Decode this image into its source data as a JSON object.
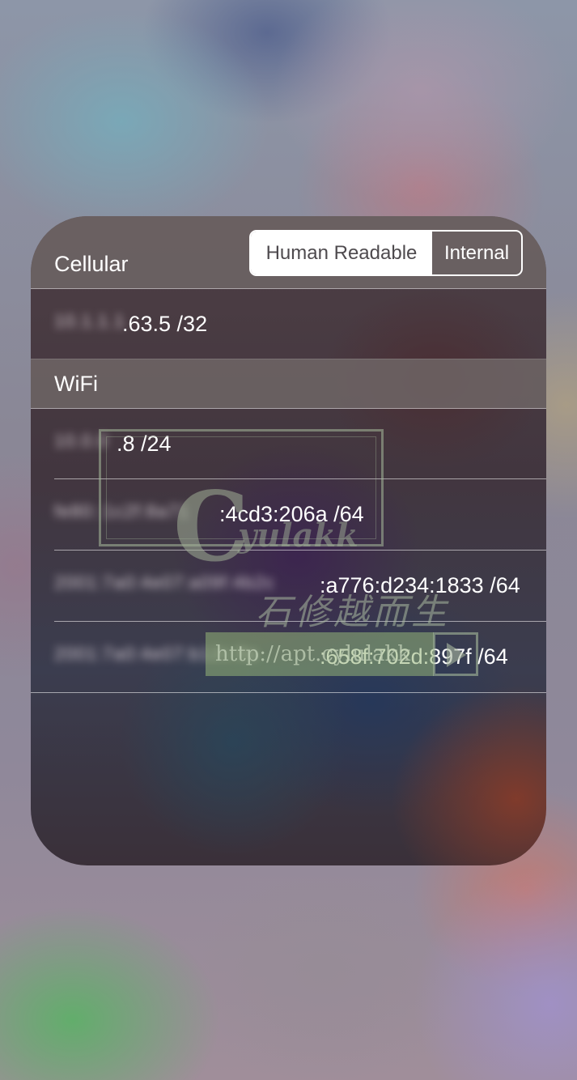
{
  "cellular": {
    "title": "Cellular",
    "address": ".63.5 /32"
  },
  "toggle": {
    "human_readable": "Human Readable",
    "internal": "Internal",
    "selected": "Human Readable"
  },
  "wifi": {
    "title": "WiFi",
    "addresses": [
      ".8 /24",
      ":4cd3:206a /64",
      ":a776:d234:1833 /64",
      ":658f:702d:897f /64"
    ]
  },
  "watermark": {
    "logo_text": "yulakk",
    "calligraphy": "石修越而生",
    "url": "http://apt.cylulakk"
  },
  "colors": {
    "header_row_bg": "#706868",
    "segment_selected_bg": "#ffffff",
    "text": "#ffffff"
  }
}
